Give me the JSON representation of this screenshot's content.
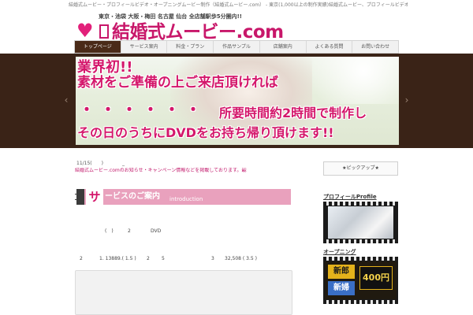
{
  "header": {
    "tagline": "結婚式ムービー・プロフィールビデオ・オープニングムービー制作（結婚式ムービー.com） - 東京(1,000以上の制作実績)結婚式ムービー、プロフィールビデオ、オープニングムービー、エンドロール作成なら（結婚式ムービー.com）へ",
    "logo_small": "東京・池袋 大阪・梅田 名古屋 仙台 全店舗駅歩5分圏内!!",
    "logo_title": "結婚式ムービー.com"
  },
  "nav": {
    "items": [
      {
        "label": "トップページ",
        "active": true
      },
      {
        "label": "サービス案内",
        "active": false
      },
      {
        "label": "料金・プラン",
        "active": false
      },
      {
        "label": "作品サンプル",
        "active": false
      },
      {
        "label": "店舗案内",
        "active": false
      },
      {
        "label": "よくある質問",
        "active": false
      },
      {
        "label": "お問い合わせ",
        "active": false
      }
    ]
  },
  "hero": {
    "line1": "業界初!!",
    "line2": "素材をご準備の上ご来店頂ければ",
    "line3": "・・・・・・",
    "line4": "所要時間約2時間で制作し",
    "line5": "その日のうちにDVDをお持ち帰り頂けます!!",
    "prev_arrow": "‹",
    "next_arrow": "›"
  },
  "main": {
    "post_date": "11/15(　　)　　　　_",
    "post_link": "結婚式ムービー.comのお知らせ・キャンペーン情報などを掲載しております。最新の情報はこちらからご確認ください。お得なプランもございます。",
    "service_big": "サ",
    "service_title": "ービスのご案内",
    "service_sub": "introduction",
    "row1": [
      "(　)",
      "2",
      "DVD"
    ],
    "row2": [
      "2",
      "1. 13889.( 1.5 )",
      "2",
      "5",
      "3",
      "32,508 ( 3.5 )"
    ]
  },
  "sidebar": {
    "box_label": "★ピックアップ★",
    "profile_label": "プロフィールProfile",
    "opening_label": "オープニング",
    "sign_a": "新郎",
    "sign_b": "新婦",
    "sign_price": "400円"
  }
}
